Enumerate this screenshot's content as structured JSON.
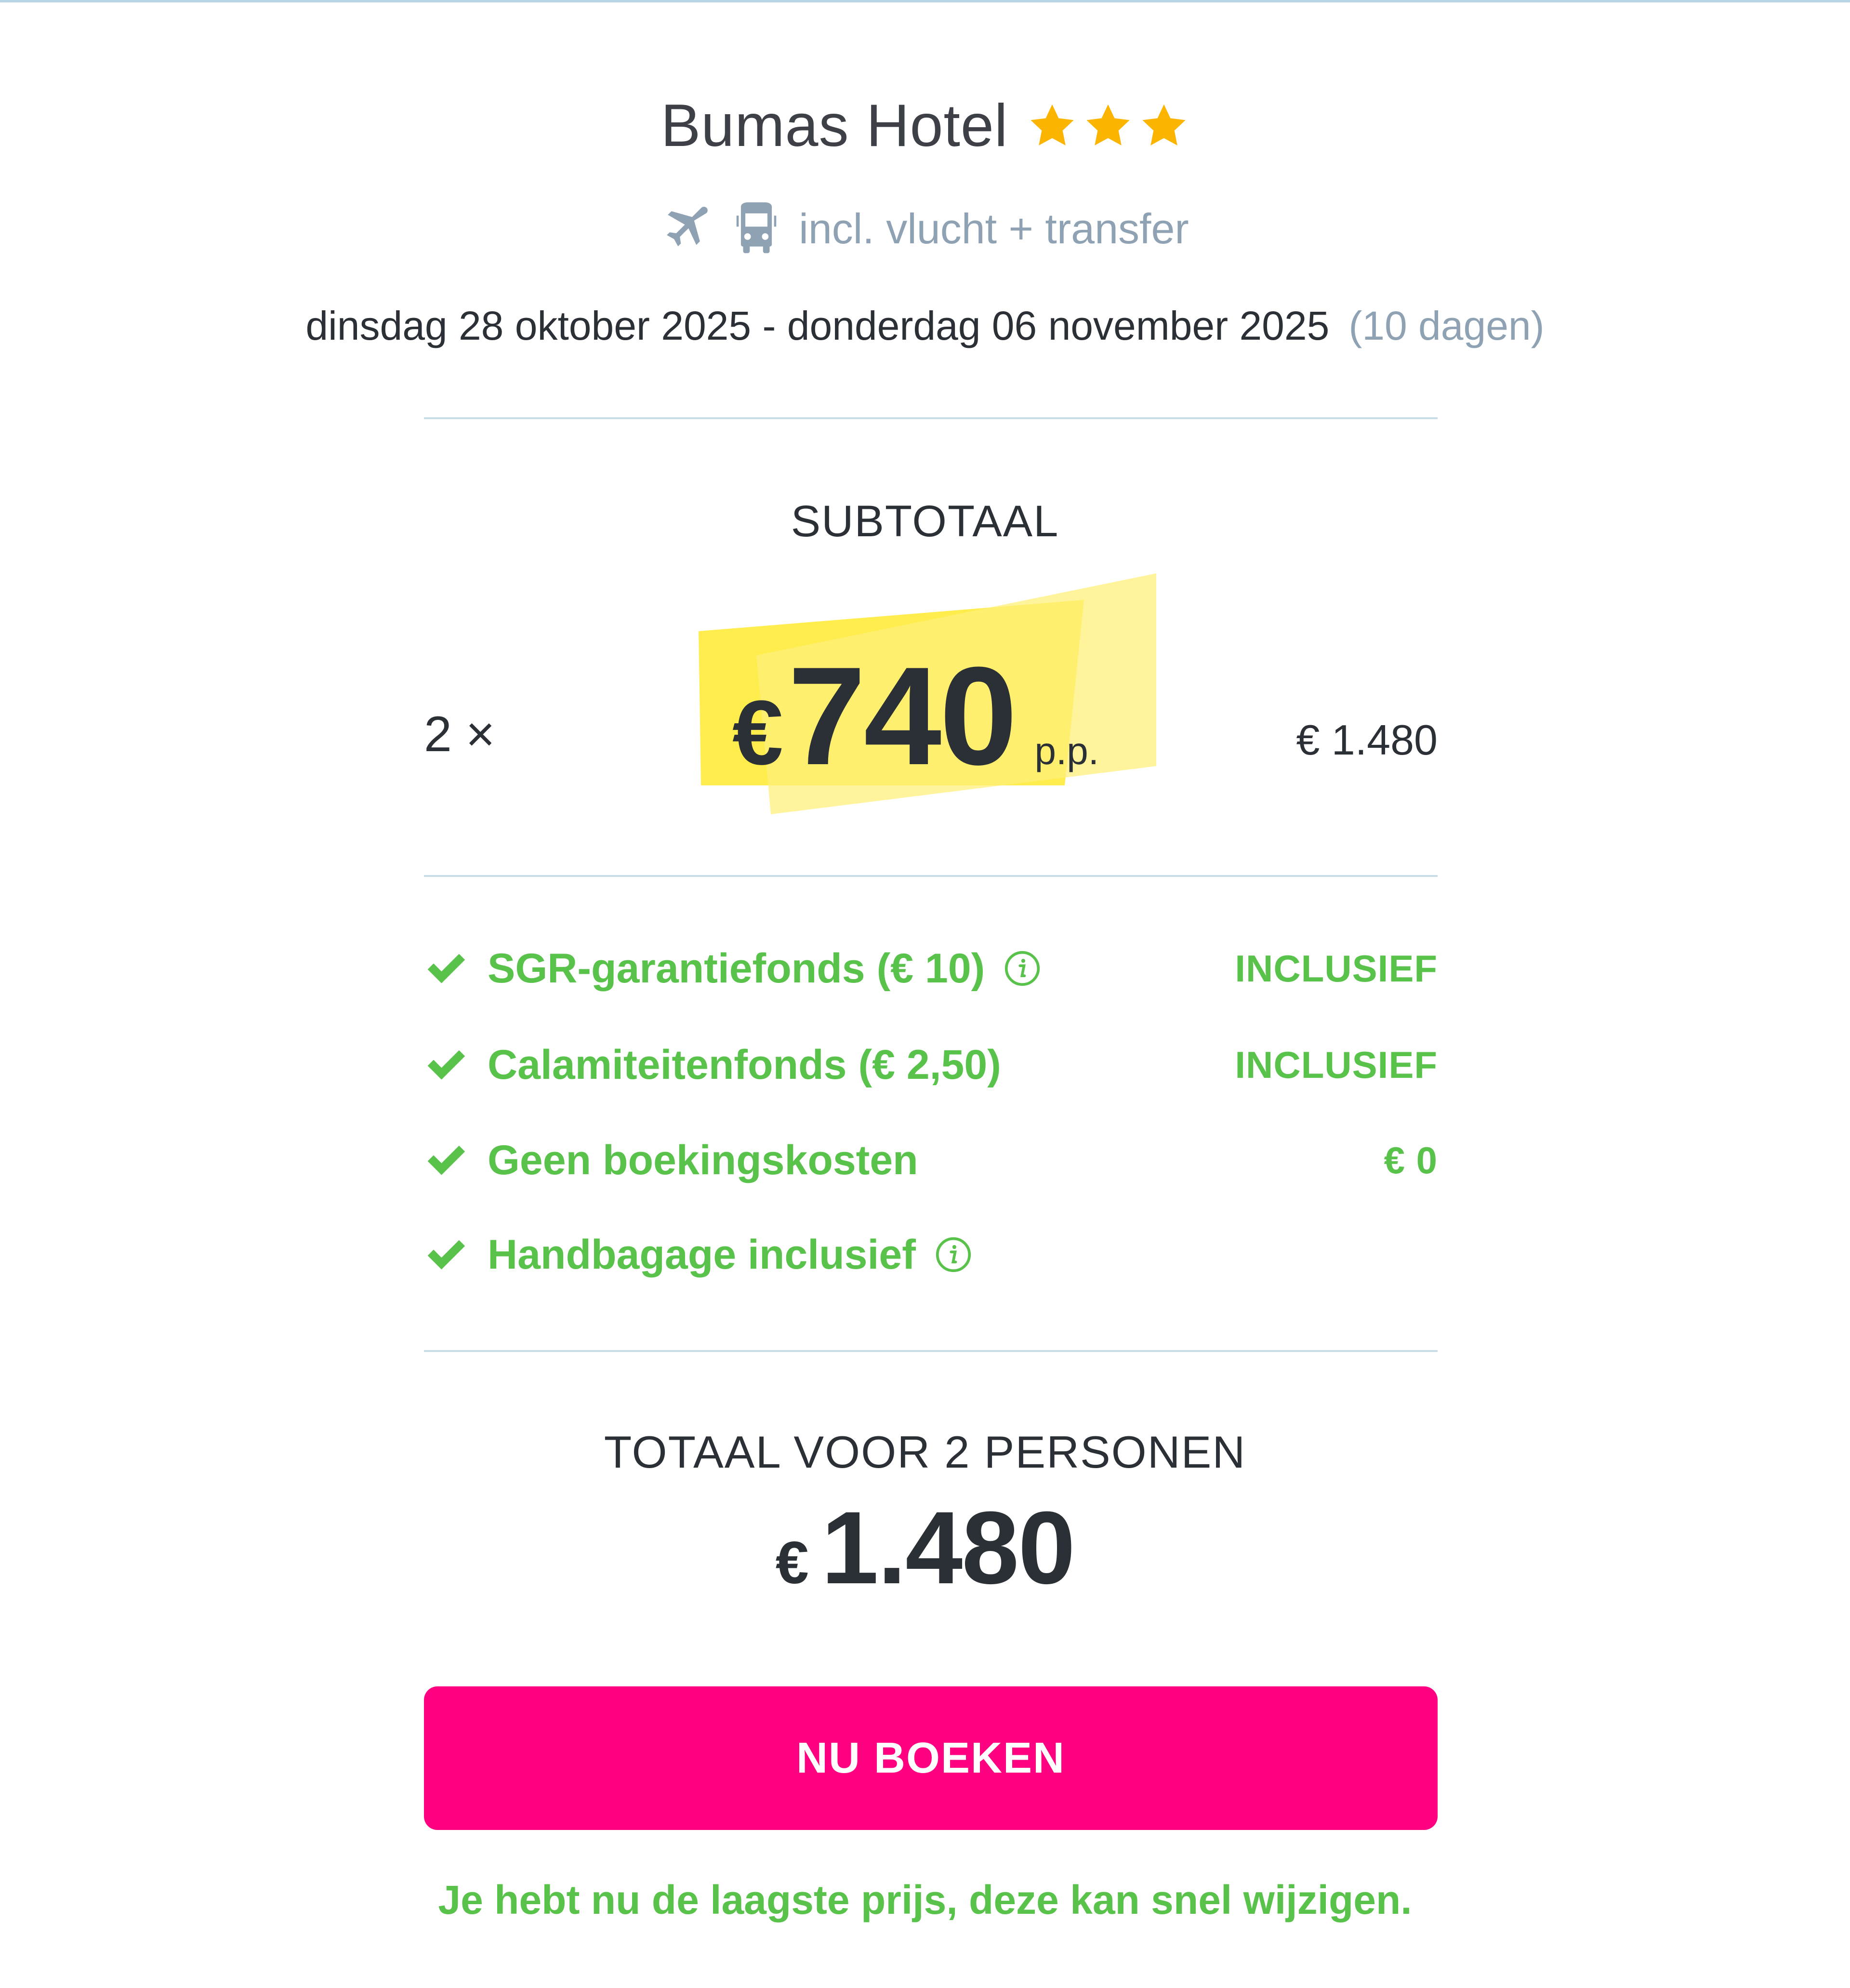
{
  "hotel": {
    "name": "Bumas Hotel",
    "stars": 3,
    "star_color": "#fbb400"
  },
  "travel": {
    "icons": [
      "plane-icon",
      "bus-icon"
    ],
    "includes_text": "incl. vlucht + transfer"
  },
  "dates": {
    "range": "dinsdag 28 oktober 2025 - donderdag 06 november 2025",
    "duration": "(10 dagen)"
  },
  "subtotal": {
    "heading": "SUBTOTAAL",
    "quantity": "2 ×",
    "currency": "€",
    "price_per_person": "740",
    "unit": "p.p.",
    "line_total": "€ 1.480",
    "highlight_color": "#ffe92e"
  },
  "fees": [
    {
      "label": "SGR-garantiefonds",
      "note": "(€ 10)",
      "info": true,
      "value": "INCLUSIEF"
    },
    {
      "label": "Calamiteitenfonds",
      "note": "(€ 2,50)",
      "info": false,
      "value": "INCLUSIEF"
    },
    {
      "label": "Geen boekingskosten",
      "note": "",
      "info": false,
      "value": "€ 0"
    },
    {
      "label": "Handbagage inclusief",
      "note": "",
      "info": true,
      "value": ""
    }
  ],
  "total": {
    "heading": "TOTAAL VOOR 2 PERSONEN",
    "currency": "€",
    "amount": "1.480"
  },
  "cta": {
    "book_label": "NU BOEKEN",
    "color": "#ff0080"
  },
  "footer_note": "Je hebt nu de laagste prijs, deze kan snel wijzigen.",
  "colors": {
    "accent_green": "#58c24a",
    "muted_blue_gray": "#8fa2b3",
    "divider": "#c9dde9"
  }
}
